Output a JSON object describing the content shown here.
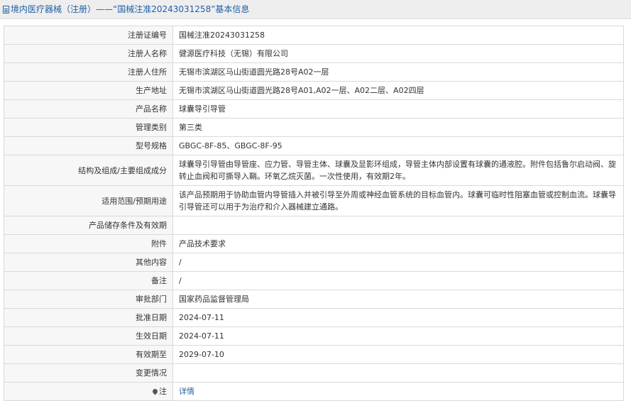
{
  "header": {
    "title": "境内医疗器械（注册）——“国械注准20243031258”基本信息"
  },
  "rows": [
    {
      "label": "注册证编号",
      "value": "国械注准20243031258"
    },
    {
      "label": "注册人名称",
      "value": "健源医疗科技（无锡）有限公司"
    },
    {
      "label": "注册人住所",
      "value": "无锡市滨湖区马山街道圆光路28号A02一层"
    },
    {
      "label": "生产地址",
      "value": "无锡市滨湖区马山街道圆光路28号A01,A02一层、A02二层、A02四层"
    },
    {
      "label": "产品名称",
      "value": "球囊导引导管"
    },
    {
      "label": "管理类别",
      "value": "第三类"
    },
    {
      "label": "型号规格",
      "value": "GBGC-8F-85、GBGC-8F-95"
    },
    {
      "label": "结构及组成/主要组成成分",
      "value": "球囊导引导管由导管座、应力管、导管主体、球囊及显影环组成，导管主体内部设置有球囊的通液腔。附件包括鲁尔启动阀、旋转止血阀和可撕导入鞘。环氧乙烷灭菌。一次性使用，有效期2年。"
    },
    {
      "label": "适用范围/预期用途",
      "value": "该产品预期用于协助血管内导管插入并被引导至外周或神经血管系统的目标血管内。球囊可临时性阻塞血管或控制血流。球囊导引导管还可以用于为治疗和介入器械建立通路。"
    },
    {
      "label": "产品储存条件及有效期",
      "value": ""
    },
    {
      "label": "附件",
      "value": "产品技术要求"
    },
    {
      "label": "其他内容",
      "value": "/"
    },
    {
      "label": "备注",
      "value": "/"
    },
    {
      "label": "审批部门",
      "value": "国家药品监督管理局"
    },
    {
      "label": "批准日期",
      "value": "2024-07-11"
    },
    {
      "label": "生效日期",
      "value": "2024-07-11"
    },
    {
      "label": "有效期至",
      "value": "2029-07-10"
    },
    {
      "label": "变更情况",
      "value": ""
    }
  ],
  "note_row": {
    "label": "注",
    "link_text": "详情",
    "icon": "pin-icon"
  }
}
